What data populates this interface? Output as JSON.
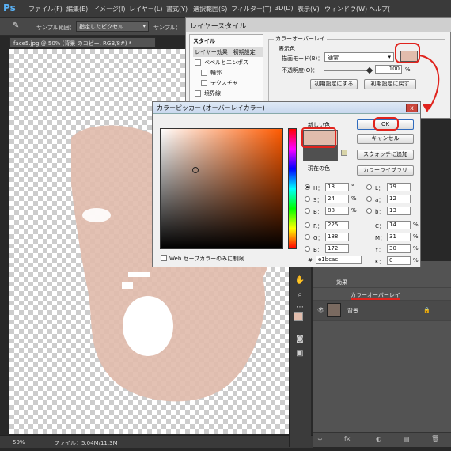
{
  "menubar": {
    "logo": "Ps",
    "items": [
      "ファイル(F)",
      "編集(E)",
      "イメージ(I)",
      "レイヤー(L)",
      "書式(Y)",
      "選択範囲(S)",
      "フィルター(T)",
      "3D(D)",
      "表示(V)",
      "ウィンドウ(W)",
      "ヘルプ("
    ]
  },
  "options": {
    "sample_size_label": "サンプル範囲：",
    "sample_size_value": "指定したピクセル",
    "sample_label": "サンプル："
  },
  "document": {
    "tab_title": "face5.jpg @ 50% (背景 のコピー, RGB/8#) *",
    "zoom": "50%",
    "file_info": "ファイル：5.04M/11.3M"
  },
  "layer_style": {
    "title": "レイヤースタイル",
    "styles_header": "スタイル",
    "blend_default": "レイヤー効果：初期設定",
    "bevel": "ベベルとエンボス",
    "contour": "輪郭",
    "texture": "テクスチャ",
    "stroke": "境界線",
    "overlay_group": "カラーオーバーレイ",
    "color_group": "表示色",
    "blend_mode_label": "描画モード(B)：",
    "blend_mode_value": "通常",
    "opacity_label": "不透明度(O)：",
    "opacity_value": "100",
    "opacity_unit": "%",
    "reset_default_btn": "初期設定にする",
    "restore_default_btn": "初期設定に戻す",
    "swatch_color": "#e1bcac"
  },
  "color_picker": {
    "title": "カラーピッカー (オーバーレイカラー)",
    "close": "x",
    "new_label": "新しい色",
    "current_label": "現在の色",
    "new_color": "#e1bcac",
    "current_color": "#505050",
    "ok": "OK",
    "cancel": "キャンセル",
    "add_swatch": "スウォッチに追加",
    "color_library": "カラーライブラリ",
    "web_only": "Web セーフカラーのみに制限",
    "hash": "#",
    "hex": "e1bcac",
    "H": "18",
    "H_unit": "°",
    "S": "24",
    "S_unit": "%",
    "B": "88",
    "B_unit": "%",
    "R": "225",
    "G": "188",
    "Bv": "172",
    "L": "79",
    "a": "12",
    "b": "13",
    "C": "14",
    "C_unit": "%",
    "M": "31",
    "M_unit": "%",
    "Y": "30",
    "Y_unit": "%",
    "K": "0",
    "K_unit": "%"
  },
  "layers": {
    "effects": "効果",
    "color_overlay": "カラーオーバーレイ",
    "background": "背景"
  },
  "colors": {
    "accent_red": "#e0231d",
    "skin": "#e1bcac"
  }
}
